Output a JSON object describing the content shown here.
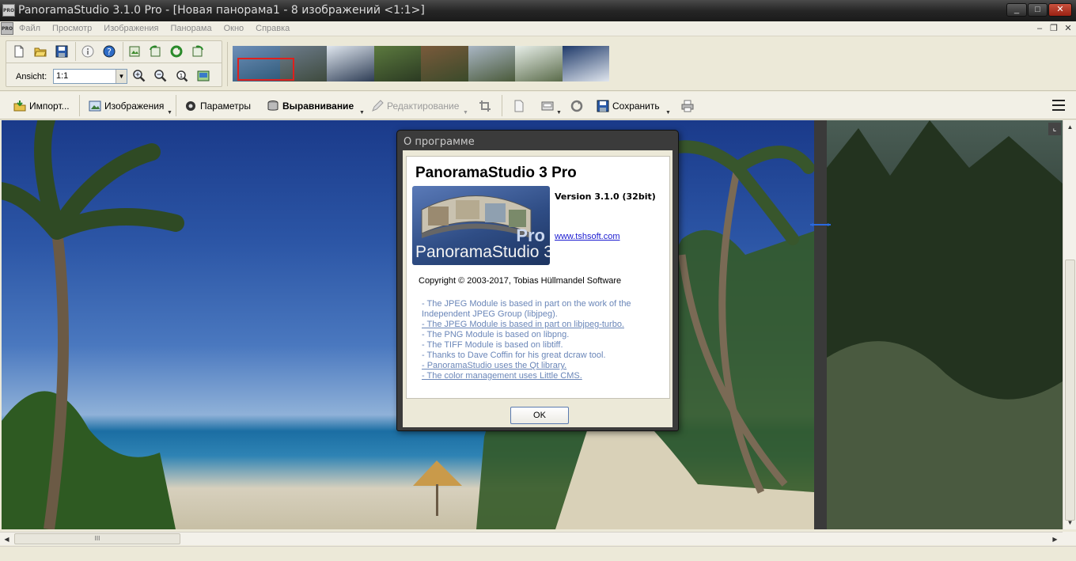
{
  "window": {
    "title": "PanoramaStudio 3.1.0 Pro - [Новая панорама1 - 8 изображений <1:1>]",
    "app_icon_text": "PRO",
    "minimize": "_",
    "maximize": "□",
    "close": "✕"
  },
  "menu": {
    "items": [
      "Файл",
      "Просмотр",
      "Изображения",
      "Панорама",
      "Окно",
      "Справка"
    ],
    "mdi_minimize": "–",
    "mdi_restore": "❐",
    "mdi_close": "✕"
  },
  "toolbar1": {
    "view_label": "Ansicht:",
    "zoom_value": "1:1",
    "icons": [
      "new-icon",
      "open-icon",
      "save-icon",
      "info-icon",
      "help-icon",
      "export-icon",
      "rotate-left-icon",
      "rotate-right-icon",
      "redo-icon",
      "zoom-in-icon",
      "zoom-out-icon",
      "zoom-100-icon",
      "fit-icon"
    ]
  },
  "thumbnails": [
    {
      "color1": "#6e8fb8",
      "color2": "#2f5a7a"
    },
    {
      "color1": "#6d7c8c",
      "color2": "#3e4a3d"
    },
    {
      "color1": "#dfe6ee",
      "color2": "#2e3d55"
    },
    {
      "color1": "#5c7a3f",
      "color2": "#2b3a22"
    },
    {
      "color1": "#7a5a3b",
      "color2": "#3a4a2a"
    },
    {
      "color1": "#a9b6c4",
      "color2": "#4a5a3a"
    },
    {
      "color1": "#e7eee8",
      "color2": "#5a6b4a"
    },
    {
      "color1": "#1f3a6a",
      "color2": "#e0e6ee"
    }
  ],
  "toolbar2": {
    "import": "Импорт...",
    "images": "Изображения",
    "params": "Параметры",
    "align": "Выравнивание",
    "edit": "Редактирование",
    "save": "Сохранить"
  },
  "dialog": {
    "title": "О программе",
    "app_name": "PanoramaStudio 3 Pro",
    "logo_pro": "Pro",
    "logo_name": "PanoramaStudio 3",
    "version": "Version 3.1.0 (32bit)",
    "url": "www.tshsoft.com",
    "copyright": "Copyright © 2003-2017, Tobias Hüllmandel Software",
    "credits": [
      {
        "text": "- The JPEG Module is based in part on the work of the",
        "link": false
      },
      {
        "text": "Independent JPEG Group (libjpeg).",
        "link": false
      },
      {
        "text": "- The JPEG Module is based in part on libjpeg-turbo.",
        "link": true
      },
      {
        "text": "- The PNG Module is based on libpng.",
        "link": false
      },
      {
        "text": "- The TIFF Module is based on libtiff.",
        "link": false
      },
      {
        "text": "- Thanks to Dave Coffin for his great dcraw tool.",
        "link": false
      },
      {
        "text": "- PanoramaStudio uses the Qt library.",
        "link": true
      },
      {
        "text": "- The color management uses Little CMS.",
        "link": true
      }
    ],
    "ok": "OK"
  },
  "scroll": {
    "h_grip": "III",
    "canvas_corner": "⌞"
  }
}
